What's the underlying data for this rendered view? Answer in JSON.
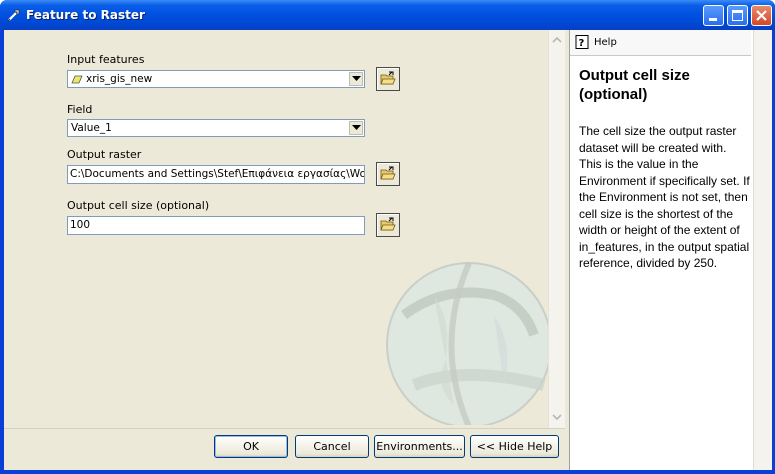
{
  "window": {
    "title": "Feature to Raster",
    "icons": {
      "app": "wrench-icon",
      "minimize": "minimize-icon",
      "maximize": "maximize-icon",
      "close": "close-icon"
    }
  },
  "form": {
    "input_features": {
      "label": "Input features",
      "value": "xris_gis_new",
      "icon": "polygon-layer-icon"
    },
    "field": {
      "label": "Field",
      "value": "Value_1"
    },
    "output_raster": {
      "label": "Output raster",
      "value": "C:\\Documents and Settings\\Stef\\Επιφάνεια εργασίας\\Work"
    },
    "output_cell_size": {
      "label": "Output cell size (optional)",
      "value": "100"
    }
  },
  "buttons": {
    "ok": "OK",
    "cancel": "Cancel",
    "environments": "Environments...",
    "hide_help": "<< Hide Help"
  },
  "help": {
    "tab_label": "Help",
    "heading": "Output cell size (optional)",
    "body": "The cell size the output raster dataset will be created with. This is the value in the Environment if specifically set. If the Environment is not set, then cell size is the shortest of the width or height of the extent of in_features, in the output spatial reference, divided by 250."
  }
}
